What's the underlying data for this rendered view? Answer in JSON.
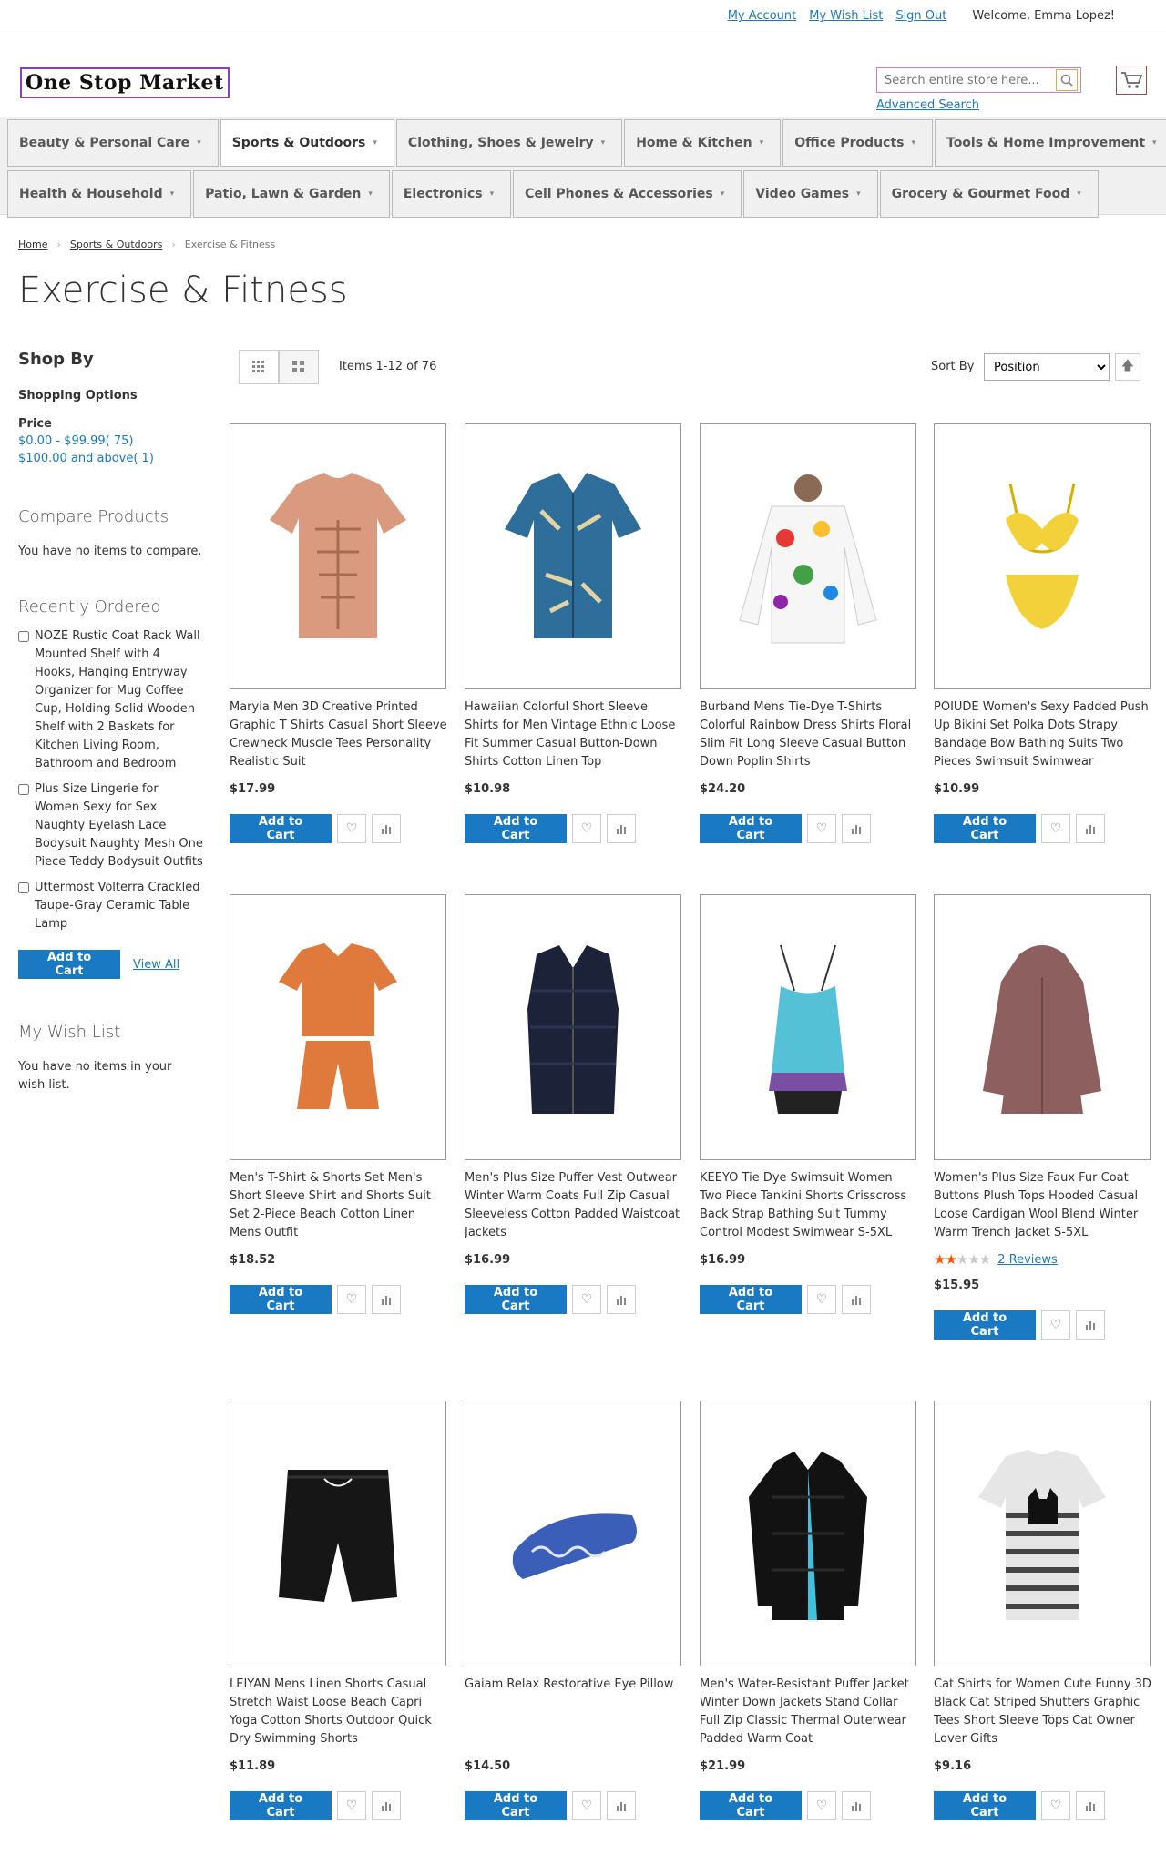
{
  "header": {
    "links": {
      "account": "My Account",
      "wishlist": "My Wish List",
      "signout": "Sign Out"
    },
    "welcome": "Welcome, Emma Lopez!",
    "logo": "One Stop Market",
    "search_placeholder": "Search entire store here...",
    "advanced_search": "Advanced Search"
  },
  "nav": {
    "row1": [
      "Beauty & Personal Care",
      "Sports & Outdoors",
      "Clothing, Shoes & Jewelry",
      "Home & Kitchen",
      "Office Products",
      "Tools & Home Improvement"
    ],
    "row2": [
      "Health & Household",
      "Patio, Lawn & Garden",
      "Electronics",
      "Cell Phones & Accessories",
      "Video Games",
      "Grocery & Gourmet Food"
    ]
  },
  "breadcrumb": {
    "home": "Home",
    "category": "Sports & Outdoors",
    "current": "Exercise & Fitness"
  },
  "page_title": "Exercise & Fitness",
  "sidebar": {
    "shop_by": "Shop By",
    "shopping_options": "Shopping Options",
    "price_label": "Price",
    "price_filters": [
      "$0.00 - $99.99( 75)",
      "$100.00 and above( 1)"
    ],
    "compare_title": "Compare Products",
    "compare_note": "You have no items to compare.",
    "recent_title": "Recently Ordered",
    "recent_items": [
      "NOZE Rustic Coat Rack Wall Mounted Shelf with 4 Hooks, Hanging Entryway Organizer for Mug Coffee Cup, Holding Solid Wooden Shelf with 2 Baskets for Kitchen Living Room, Bathroom and Bedroom",
      "Plus Size Lingerie for Women Sexy for Sex Naughty Eyelash Lace Bodysuit Naughty Mesh One Piece Teddy Bodysuit Outfits",
      "Uttermost Volterra Crackled Taupe-Gray Ceramic Table Lamp"
    ],
    "add_to_cart": "Add to Cart",
    "view_all": "View All",
    "wishlist_title": "My Wish List",
    "wishlist_note": "You have no items in your wish list."
  },
  "toolbar": {
    "amount": "Items 1-12 of 76",
    "sort_label": "Sort By",
    "sort_value": "Position"
  },
  "products": [
    {
      "name": "Maryia Men 3D Creative Printed Graphic T Shirts Casual Short Sleeve Crewneck Muscle Tees Personality Realistic Suit",
      "price": "$17.99"
    },
    {
      "name": "Hawaiian Colorful Short Sleeve Shirts for Men Vintage Ethnic Loose Fit Summer Casual Button-Down Shirts Cotton Linen Top",
      "price": "$10.98"
    },
    {
      "name": "Burband Mens Tie-Dye T-Shirts Colorful Rainbow Dress Shirts Floral Slim Fit Long Sleeve Casual Button Down Poplin Shirts",
      "price": "$24.20"
    },
    {
      "name": "POIUDE Women's Sexy Padded Push Up Bikini Set Polka Dots Strapy Bandage Bow Bathing Suits Two Pieces Swimsuit Swimwear",
      "price": "$10.99"
    },
    {
      "name": "Men's T-Shirt & Shorts Set Men's Short Sleeve Shirt and Shorts Suit Set 2-Piece Beach Cotton Linen Mens Outfit",
      "price": "$18.52"
    },
    {
      "name": "Men's Plus Size Puffer Vest Outwear Winter Warm Coats Full Zip Casual Sleeveless Cotton Padded Waistcoat Jackets",
      "price": "$16.99"
    },
    {
      "name": "KEEYO Tie Dye Swimsuit Women Two Piece Tankini Shorts Crisscross Back Strap Bathing Suit Tummy Control Modest Swimwear S-5XL",
      "price": "$16.99"
    },
    {
      "name": "Women's Plus Size Faux Fur Coat Buttons Plush Tops Hooded Casual Loose Cardigan Wool Blend Winter Warm Trench Jacket S-5XL",
      "price": "$15.95",
      "reviews": "2 Reviews",
      "rating": 2
    },
    {
      "name": "LEIYAN Mens Linen Shorts Casual Stretch Waist Loose Beach Capri Yoga Cotton Shorts Outdoor Quick Dry Swimming Shorts",
      "price": "$11.89"
    },
    {
      "name": "Gaiam Relax Restorative Eye Pillow",
      "price": "$14.50"
    },
    {
      "name": "Men's Water-Resistant Puffer Jacket Winter Down Jackets Stand Collar Full Zip Classic Thermal Outerwear Padded Warm Coat",
      "price": "$21.99"
    },
    {
      "name": "Cat Shirts for Women Cute Funny 3D Black Cat Striped Shutters Graphic Tees Short Sleeve Tops Cat Owner Lover Gifts",
      "price": "$9.16"
    }
  ],
  "product_add_to_cart": "Add to Cart",
  "colors": {
    "primary": "#1979c3",
    "star": "#ff5501"
  }
}
